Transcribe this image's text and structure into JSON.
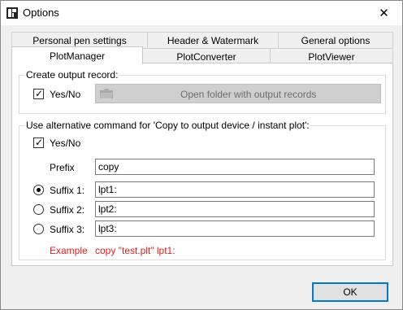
{
  "window": {
    "title": "Options",
    "close_glyph": "✕",
    "app_icon": "app-icon"
  },
  "tabs": {
    "row1": [
      "Personal pen settings",
      "Header & Watermark",
      "General options"
    ],
    "row2": [
      "PlotManager",
      "PlotConverter",
      "PlotViewer"
    ],
    "active": "PlotManager"
  },
  "output_record": {
    "title": "Create output record:",
    "yes_no_label": "Yes/No",
    "checked": true,
    "open_folder_label": "Open folder with output records",
    "open_folder_icon": "folder-icon"
  },
  "alt_command": {
    "title": "Use alternative command for 'Copy to output device / instant plot':",
    "yes_no_label": "Yes/No",
    "checked": true,
    "prefix_label": "Prefix",
    "prefix_value": "copy",
    "suffixes": [
      {
        "label": "Suffix 1:",
        "value": "lpt1:",
        "selected": true
      },
      {
        "label": "Suffix 2:",
        "value": "lpt2:",
        "selected": false
      },
      {
        "label": "Suffix 3:",
        "value": "lpt3:",
        "selected": false
      }
    ],
    "example_label": "Example",
    "example_value": "copy \"test.plt\" lpt1:"
  },
  "footer": {
    "ok_label": "OK"
  },
  "colors": {
    "example_text": "#e0201e",
    "focus_border": "#0078d7"
  }
}
